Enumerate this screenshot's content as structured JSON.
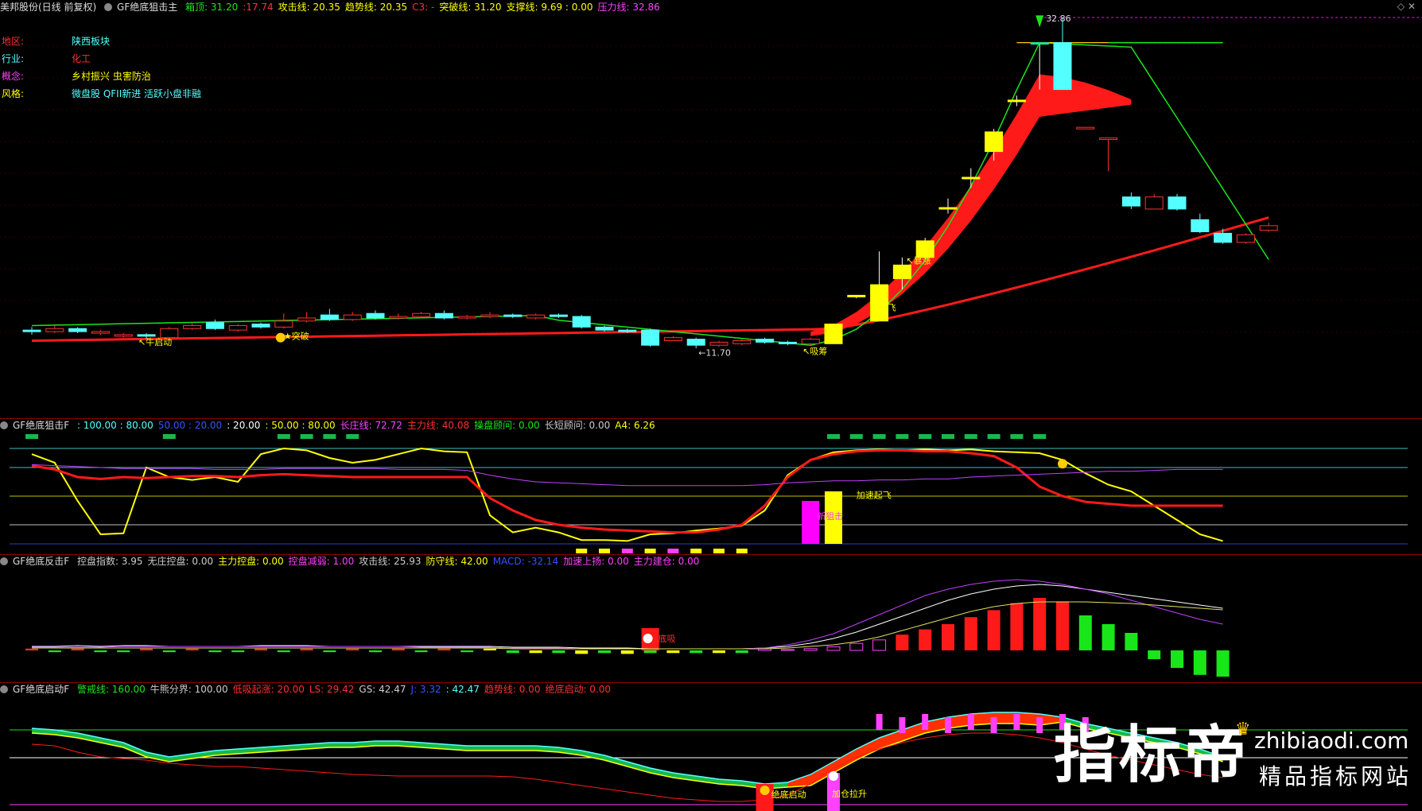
{
  "colors": {
    "up": "#ff3030",
    "down": "#54ffff",
    "ma_green": "#19e619",
    "ma_red": "#ff1a1a",
    "yellow": "#ffff00",
    "magenta": "#ff00ff",
    "white": "#ffffff",
    "bg": "#000000",
    "sep": "#8b0000"
  },
  "main": {
    "stock": "美邦股份(日线 前复权)",
    "indicator": "GF绝底狙击主",
    "items": [
      {
        "label": "箱顶: 31.20",
        "color": "#19e619"
      },
      {
        "label": ":17.74",
        "color": "#ff3030"
      },
      {
        "label": "攻击线: 20.35",
        "color": "#ffff00"
      },
      {
        "label": "趋势线: 20.35",
        "color": "#ffff00"
      },
      {
        "label": "C3: -",
        "color": "#ff3030"
      },
      {
        "label": "突破线: 31.20",
        "color": "#ffff00"
      },
      {
        "label": "支撑线: 9.69 : 0.00",
        "color": "#ffff00"
      },
      {
        "label": "压力线: 32.86",
        "color": "#ff40ff"
      }
    ],
    "info": [
      {
        "key": "地区:",
        "value": "陕西板块",
        "kcolor": "#ff3030",
        "vcolor": "#54ffff"
      },
      {
        "key": "行业:",
        "value": "化工",
        "kcolor": "#54ffff",
        "vcolor": "#ff3030"
      },
      {
        "key": "概念:",
        "value": "乡村振兴 虫害防治",
        "kcolor": "#ff40ff",
        "vcolor": "#ffff00"
      },
      {
        "key": "风格:",
        "value": "微盘股 QFII新进 活跃小盘非融",
        "kcolor": "#ffff00",
        "vcolor": "#54ffff"
      }
    ],
    "price_high": "32.86",
    "price_low": "11.70",
    "marks": {
      "niu": "↖牛启动",
      "tupo": "★突破",
      "xichou": "↖吸筹",
      "qifei": "↖起飞",
      "baozhang": "↖暴涨"
    },
    "candles": [
      {
        "o": 12.2,
        "c": 12.1,
        "h": 12.4,
        "l": 11.9
      },
      {
        "o": 12.1,
        "c": 12.3,
        "h": 12.5,
        "l": 12.0
      },
      {
        "o": 12.3,
        "c": 12.1,
        "h": 12.4,
        "l": 12.0
      },
      {
        "o": 12.0,
        "c": 12.1,
        "h": 12.2,
        "l": 11.9
      },
      {
        "o": 11.8,
        "c": 11.9,
        "h": 12.0,
        "l": 11.7
      },
      {
        "o": 11.9,
        "c": 11.8,
        "h": 12.0,
        "l": 11.6
      },
      {
        "o": 11.7,
        "c": 12.3,
        "h": 12.4,
        "l": 11.7
      },
      {
        "o": 12.3,
        "c": 12.5,
        "h": 12.7,
        "l": 12.2
      },
      {
        "o": 12.7,
        "c": 12.3,
        "h": 12.9,
        "l": 12.2
      },
      {
        "o": 12.2,
        "c": 12.5,
        "h": 12.6,
        "l": 12.1
      },
      {
        "o": 12.6,
        "c": 12.4,
        "h": 12.7,
        "l": 12.3
      },
      {
        "o": 12.4,
        "c": 12.8,
        "h": 13.3,
        "l": 12.3
      },
      {
        "o": 12.8,
        "c": 13.0,
        "h": 13.4,
        "l": 12.7
      },
      {
        "o": 13.2,
        "c": 12.9,
        "h": 13.6,
        "l": 12.8
      },
      {
        "o": 12.9,
        "c": 13.2,
        "h": 13.4,
        "l": 12.8
      },
      {
        "o": 13.3,
        "c": 13.0,
        "h": 13.5,
        "l": 12.9
      },
      {
        "o": 13.0,
        "c": 13.1,
        "h": 13.3,
        "l": 12.9
      },
      {
        "o": 13.1,
        "c": 13.3,
        "h": 13.4,
        "l": 13.0
      },
      {
        "o": 13.3,
        "c": 13.0,
        "h": 13.5,
        "l": 12.9
      },
      {
        "o": 13.0,
        "c": 13.1,
        "h": 13.2,
        "l": 12.9
      },
      {
        "o": 13.1,
        "c": 13.2,
        "h": 13.4,
        "l": 13.0
      },
      {
        "o": 13.2,
        "c": 13.1,
        "h": 13.3,
        "l": 13.0
      },
      {
        "o": 13.0,
        "c": 13.2,
        "h": 13.3,
        "l": 12.9
      },
      {
        "o": 13.2,
        "c": 13.1,
        "h": 13.3,
        "l": 13.0
      },
      {
        "o": 13.1,
        "c": 12.4,
        "h": 13.2,
        "l": 12.3
      },
      {
        "o": 12.4,
        "c": 12.2,
        "h": 12.5,
        "l": 12.1
      },
      {
        "o": 12.2,
        "c": 12.1,
        "h": 12.3,
        "l": 12.0
      },
      {
        "o": 12.2,
        "c": 11.2,
        "h": 12.3,
        "l": 11.1
      },
      {
        "o": 11.5,
        "c": 11.7,
        "h": 11.8,
        "l": 11.5
      },
      {
        "o": 11.6,
        "c": 11.2,
        "h": 11.7,
        "l": 11.0
      },
      {
        "o": 11.2,
        "c": 11.4,
        "h": 11.5,
        "l": 11.1
      },
      {
        "o": 11.3,
        "c": 11.5,
        "h": 11.6,
        "l": 11.2
      },
      {
        "o": 11.6,
        "c": 11.4,
        "h": 11.7,
        "l": 11.3
      },
      {
        "o": 11.4,
        "c": 11.3,
        "h": 11.5,
        "l": 11.2
      },
      {
        "o": 11.3,
        "c": 11.6,
        "h": 11.7,
        "l": 11.2
      },
      {
        "o": 11.3,
        "c": 12.6,
        "h": 12.6,
        "l": 11.3
      },
      {
        "o": 14.4,
        "c": 14.5,
        "h": 14.5,
        "l": 14.3
      },
      {
        "o": 12.8,
        "c": 15.2,
        "h": 17.4,
        "l": 12.8
      },
      {
        "o": 15.6,
        "c": 16.5,
        "h": 17.0,
        "l": 14.9
      },
      {
        "o": 17.0,
        "c": 18.1,
        "h": 18.3,
        "l": 16.9
      },
      {
        "o": 20.3,
        "c": 20.3,
        "h": 20.9,
        "l": 19.9
      },
      {
        "o": 22.3,
        "c": 22.3,
        "h": 22.9,
        "l": 21.6
      },
      {
        "o": 24.0,
        "c": 25.3,
        "h": 25.5,
        "l": 23.4
      },
      {
        "o": 27.4,
        "c": 27.4,
        "h": 27.7,
        "l": 27.0
      },
      {
        "o": 31.2,
        "c": 31.2,
        "h": 31.2,
        "l": 28.1
      },
      {
        "o": 31.2,
        "c": 28.1,
        "h": 32.86,
        "l": 28.1
      },
      {
        "o": 25.6,
        "c": 25.6,
        "h": 25.6,
        "l": 25.6
      },
      {
        "o": 24.9,
        "c": 24.9,
        "h": 24.9,
        "l": 22.7
      },
      {
        "o": 21.0,
        "c": 20.4,
        "h": 21.3,
        "l": 20.2
      },
      {
        "o": 20.2,
        "c": 21.0,
        "h": 21.2,
        "l": 20.2
      },
      {
        "o": 21.0,
        "c": 20.2,
        "h": 21.2,
        "l": 20.1
      },
      {
        "o": 19.5,
        "c": 18.7,
        "h": 19.9,
        "l": 18.6
      },
      {
        "o": 18.6,
        "c": 18.0,
        "h": 18.9,
        "l": 17.9
      },
      {
        "o": 18.0,
        "c": 18.5,
        "h": 18.6,
        "l": 17.9
      },
      {
        "o": 18.8,
        "c": 19.1,
        "h": 19.3,
        "l": 18.7
      }
    ]
  },
  "p2": {
    "indicator": "GF绝底狙击F",
    "items": [
      {
        "label": ": 100.00 : 80.00",
        "color": "#54ffff"
      },
      {
        "label": "50.00 : 20.00",
        "color": "#3355ff"
      },
      {
        "label": ": 20.00",
        "color": "#ffffff"
      },
      {
        "label": ": 50.00 : 80.00",
        "color": "#ffff00"
      },
      {
        "label": "长庄线: 72.72",
        "color": "#ff40ff"
      },
      {
        "label": "主力线: 40.08",
        "color": "#ff3030"
      },
      {
        "label": "操盘顾问: 0.00",
        "color": "#19e619"
      },
      {
        "label": "长短顾问: 0.00",
        "color": "#cccccc"
      },
      {
        "label": "A4: 6.26",
        "color": "#ffff00"
      }
    ],
    "marks": {
      "jiasu": "加速起飞",
      "bengsha": "新狙击"
    }
  },
  "p3": {
    "indicator": "GF绝底反击F",
    "items": [
      {
        "label": "控盘指数: 3.95",
        "color": "#cccccc"
      },
      {
        "label": "无庄控盘: 0.00",
        "color": "#cccccc"
      },
      {
        "label": "主力控盘: 0.00",
        "color": "#ffff00"
      },
      {
        "label": "控盘减弱: 1.00",
        "color": "#ff40ff"
      },
      {
        "label": "攻击线: 25.93",
        "color": "#cccccc"
      },
      {
        "label": "防守线: 42.00",
        "color": "#ffff00"
      },
      {
        "label": "MACD: -32.14",
        "color": "#3355ff"
      },
      {
        "label": "加速上扬: 0.00",
        "color": "#ff40ff"
      },
      {
        "label": "主力建仓: 0.00",
        "color": "#ff40ff"
      }
    ],
    "marks": {
      "dixi": "底吸"
    }
  },
  "p4": {
    "indicator": "GF绝底启动F",
    "items": [
      {
        "label": "警戒线: 160.00",
        "color": "#19e619"
      },
      {
        "label": "牛熊分界: 100.00",
        "color": "#cccccc"
      },
      {
        "label": "低吸起涨: 20.00",
        "color": "#ff3030"
      },
      {
        "label": "LS: 29.42",
        "color": "#ff3030"
      },
      {
        "label": "GS: 42.47",
        "color": "#cccccc"
      },
      {
        "label": "J: 3.32",
        "color": "#3355ff"
      },
      {
        "label": ": 42.47",
        "color": "#54ffff"
      },
      {
        "label": "趋势线: 0.00",
        "color": "#ff3030"
      },
      {
        "label": "绝底启动: 0.00",
        "color": "#ff3030"
      }
    ],
    "marks": {
      "juedi": "绝底启动",
      "jiachang": "加仓拉升"
    }
  },
  "watermark": {
    "cn": "指标帝",
    "en": "zhibiaodi.com",
    "sub": "精品指标网站"
  }
}
